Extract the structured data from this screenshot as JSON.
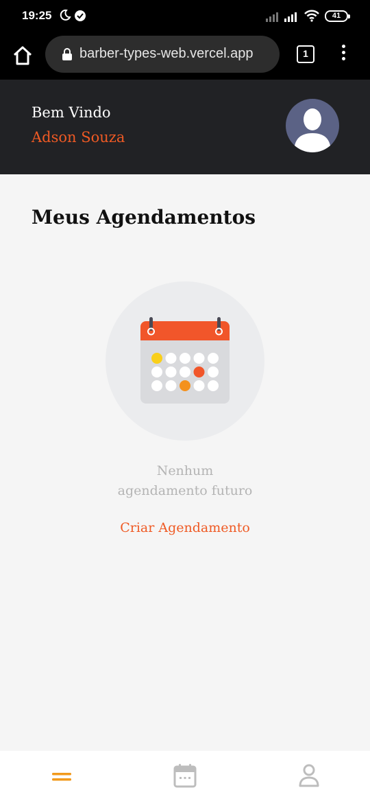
{
  "status_bar": {
    "time": "19:25",
    "battery": "41",
    "icons": [
      "moon-icon",
      "check-circle-icon",
      "signal-icon",
      "signal-icon",
      "wifi-icon",
      "battery-icon"
    ]
  },
  "browser": {
    "url": "barber-types-web.vercel.app",
    "tab_count": "1",
    "icons": [
      "home-icon",
      "lock-icon",
      "tabs-icon",
      "menu-dots-icon"
    ]
  },
  "header": {
    "greeting": "Bem Vindo",
    "user_name": "Adson Souza",
    "avatar_icon": "user-avatar-icon"
  },
  "main": {
    "title": "Meus Agendamentos",
    "empty_state": {
      "icon": "calendar-icon",
      "line1": "Nenhum",
      "line2": "agendamento futuro",
      "action_label": "Criar Agendamento"
    }
  },
  "bottom_nav": {
    "items": [
      {
        "name": "home",
        "icon": "menu-bars-icon",
        "active": true
      },
      {
        "name": "appointments",
        "icon": "calendar-icon",
        "active": false
      },
      {
        "name": "profile",
        "icon": "user-icon",
        "active": false
      }
    ]
  },
  "colors": {
    "accent": "#ef5a24",
    "header_bg": "#212225",
    "page_bg": "#f5f5f5",
    "nav_active": "#f29a1d",
    "nav_inactive": "#bdbdbd"
  }
}
